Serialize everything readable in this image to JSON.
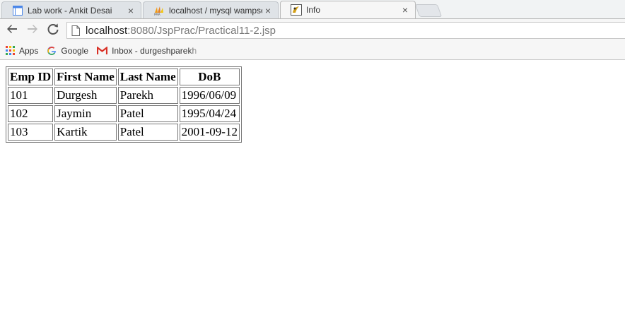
{
  "browser": {
    "tabs": [
      {
        "title": "Lab work - Ankit Desai",
        "close": "×",
        "active": false
      },
      {
        "title": "localhost / mysql wampse",
        "close": "×",
        "active": false
      },
      {
        "title": "Info",
        "close": "×",
        "active": true
      }
    ],
    "address": {
      "host": "localhost",
      "rest": ":8080/JspPrac/Practical11-2.jsp"
    },
    "bookmarks": [
      {
        "label": "Apps",
        "icon": "apps-grid-icon"
      },
      {
        "label": "Google",
        "icon": "google-g-icon"
      },
      {
        "label": "Inbox - durgeshparekh",
        "icon": "gmail-m-icon"
      }
    ]
  },
  "table": {
    "headers": [
      "Emp ID",
      "First Name",
      "Last Name",
      "DoB"
    ],
    "rows": [
      [
        "101",
        "Durgesh",
        "Parekh",
        "1996/06/09"
      ],
      [
        "102",
        "Jaymin",
        "Patel",
        "1995/04/24"
      ],
      [
        "103",
        "Kartik",
        "Patel",
        "2001-09-12"
      ]
    ]
  },
  "colors": {
    "active_tab": "#f6f6f6",
    "tab_strip": "#f1f3f4",
    "google_blue": "#4285f4",
    "gmail_red": "#d93025"
  }
}
